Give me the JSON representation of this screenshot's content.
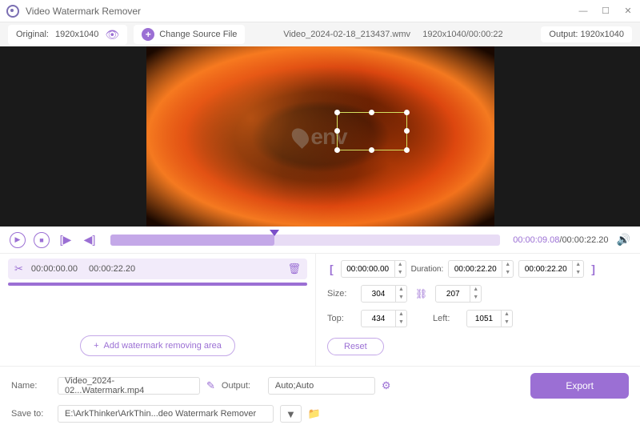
{
  "app": {
    "title": "Video Watermark Remover"
  },
  "toolbar": {
    "original_label": "Original:",
    "original_res": "1920x1040",
    "change_source": "Change Source File",
    "file_name": "Video_2024-02-18_213437.wmv",
    "file_meta": "1920x1040/00:00:22",
    "output_label": "Output:",
    "output_res": "1920x1040"
  },
  "watermark_text": "env",
  "playback": {
    "current": "00:00:09.08",
    "total": "00:00:22.20"
  },
  "segment": {
    "start": "00:00:00.00",
    "end": "00:00:22.20"
  },
  "range": {
    "start": "00:00:00.00",
    "duration_label": "Duration:",
    "duration": "00:00:22.20",
    "end": "00:00:22.20"
  },
  "size": {
    "label": "Size:",
    "w": "304",
    "h": "207"
  },
  "pos": {
    "top_label": "Top:",
    "top": "434",
    "left_label": "Left:",
    "left": "1051"
  },
  "buttons": {
    "reset": "Reset",
    "add_area": "Add watermark removing area",
    "export": "Export"
  },
  "output": {
    "name_label": "Name:",
    "name": "Video_2024-02...Watermark.mp4",
    "out_label": "Output:",
    "out_val": "Auto;Auto",
    "save_label": "Save to:",
    "save_path": "E:\\ArkThinker\\ArkThin...deo Watermark Remover"
  }
}
